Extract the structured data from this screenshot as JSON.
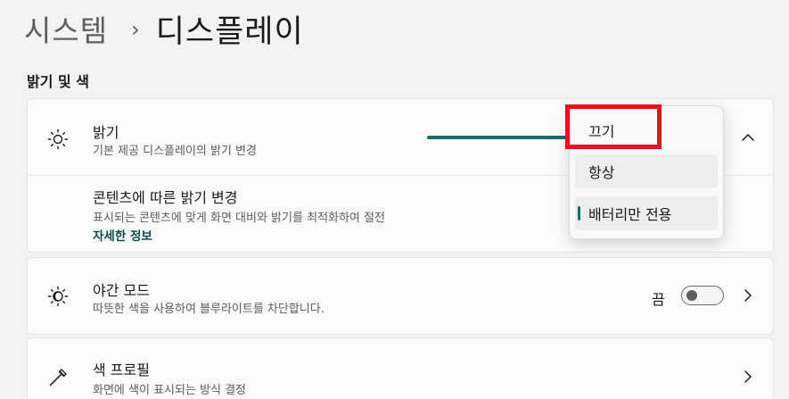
{
  "breadcrumb": {
    "parent": "시스템",
    "separator": "›",
    "current": "디스플레이"
  },
  "section_title": "밝기 및 색",
  "brightness": {
    "icon": "sun-icon",
    "title": "밝기",
    "description": "기본 제공 디스플레이의 밝기 변경",
    "expand_icon": "chevron-up-icon"
  },
  "content_brightness": {
    "title": "콘텐츠에 따른 밝기 변경",
    "description": "표시되는 콘텐츠에 맞게 화면 대비와 밝기를 최적화하여 절전",
    "link": "자세한 정보"
  },
  "dropdown": {
    "options": [
      "끄기",
      "항상",
      "배터리만 전용"
    ],
    "selected": "배터리만 전용"
  },
  "night_mode": {
    "icon": "night-light-icon",
    "title": "야간 모드",
    "description": "따뜻한 색을 사용하여 블루라이트를 차단합니다.",
    "toggle_label": "끔",
    "toggle_on": false
  },
  "color_profile": {
    "icon": "eyedropper-icon",
    "title": "색 프로필",
    "description": "화면에 색이 표시되는 방식 결정"
  },
  "colors": {
    "accent": "#1c6b66",
    "highlight": "#e8121b"
  }
}
